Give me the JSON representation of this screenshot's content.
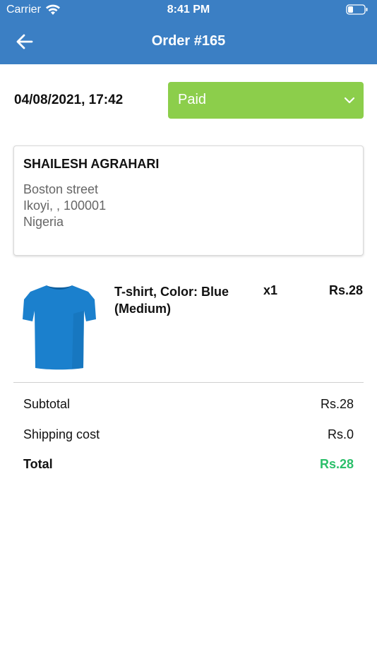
{
  "status_bar": {
    "carrier": "Carrier",
    "time": "8:41 PM"
  },
  "header": {
    "title": "Order #165"
  },
  "order": {
    "datetime": "04/08/2021, 17:42",
    "status": "Paid",
    "status_color": "#8cce4b"
  },
  "customer": {
    "name": "SHAILESH AGRAHARI",
    "address_line1": "Boston street",
    "address_line2": "Ikoyi, , 100001",
    "address_line3": "Nigeria"
  },
  "items": [
    {
      "name": "T-shirt, Color: Blue (Medium)",
      "quantity": "x1",
      "price": "Rs.28",
      "icon": "tshirt-image"
    }
  ],
  "summary": {
    "subtotal_label": "Subtotal",
    "subtotal_value": "Rs.28",
    "shipping_label": "Shipping cost",
    "shipping_value": "Rs.0",
    "total_label": "Total",
    "total_value": "Rs.28",
    "total_color": "#2bbf6a"
  },
  "colors": {
    "header": "#3b7fc4"
  }
}
